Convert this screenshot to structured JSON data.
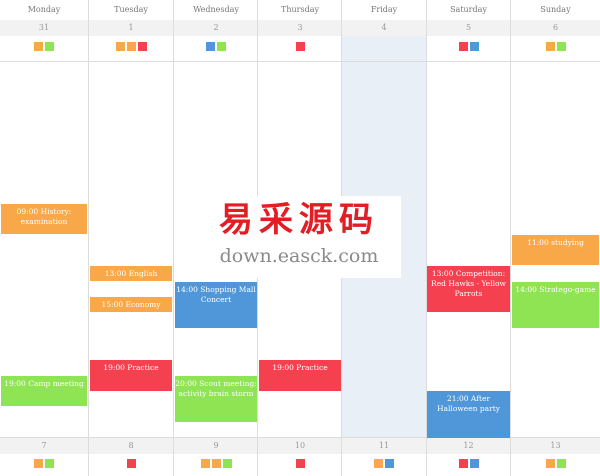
{
  "days": [
    "Monday",
    "Tuesday",
    "Wednesday",
    "Thursday",
    "Friday",
    "Saturday",
    "Sunday"
  ],
  "week1": {
    "dates": [
      "31",
      "1",
      "2",
      "3",
      "4",
      "5",
      "6"
    ],
    "markers": [
      [
        "orange",
        "green"
      ],
      [
        "orange",
        "orange",
        "red"
      ],
      [
        "blue",
        "green"
      ],
      [
        "red"
      ],
      [],
      [
        "red",
        "blue"
      ],
      [
        "orange",
        "green"
      ]
    ]
  },
  "week2": {
    "dates": [
      "7",
      "8",
      "9",
      "10",
      "11",
      "12",
      "13"
    ],
    "markers": [
      [
        "orange",
        "green"
      ],
      [
        "red"
      ],
      [
        "orange",
        "orange",
        "green"
      ],
      [
        "red"
      ],
      [
        "orange",
        "blue"
      ],
      [
        "red",
        "blue"
      ],
      [
        "orange",
        "green"
      ]
    ]
  },
  "colors": {
    "orange": "#f8a849",
    "green": "#8ee453",
    "red": "#f4404f",
    "blue": "#4f97d9"
  },
  "events": [
    {
      "day": 0,
      "text": "09:00 History: examination",
      "color": "orange"
    },
    {
      "day": 0,
      "text": "19:00 Camp meeting",
      "color": "green"
    },
    {
      "day": 1,
      "text": "13:00 English",
      "color": "orange"
    },
    {
      "day": 1,
      "text": "15:00 Economy",
      "color": "orange"
    },
    {
      "day": 1,
      "text": "19:00 Practice",
      "color": "red"
    },
    {
      "day": 2,
      "text": "14:00 Shopping Mall Concert",
      "color": "blue"
    },
    {
      "day": 2,
      "text": "20:00 Scout meeting: activity brain storm",
      "color": "green"
    },
    {
      "day": 3,
      "text": "19:00 Practice",
      "color": "red"
    },
    {
      "day": 5,
      "text": "13:00 Competition: Red Hawks - Yellow Parrots",
      "color": "red"
    },
    {
      "day": 5,
      "text": "21:00 After Halloween party",
      "color": "blue"
    },
    {
      "day": 6,
      "text": "11:00 studying",
      "color": "orange"
    },
    {
      "day": 6,
      "text": "14:00 Stratego-game",
      "color": "green"
    }
  ],
  "watermark": {
    "chinese": "易采源码",
    "url": "down.easck.com"
  }
}
